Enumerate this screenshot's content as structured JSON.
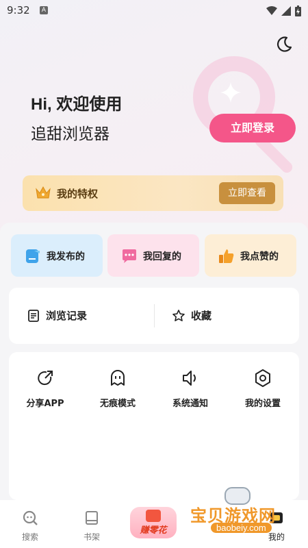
{
  "status": {
    "time": "9:32",
    "badge": "A"
  },
  "header": {
    "greeting": "Hi, 欢迎使用",
    "app_name": "追甜浏览器",
    "login_label": "立即登录"
  },
  "privilege": {
    "label": "我的特权",
    "button": "立即查看"
  },
  "quick_tiles": [
    {
      "label": "我发布的",
      "icon": "post-icon",
      "color": "#3fa3ea"
    },
    {
      "label": "我回复的",
      "icon": "chat-icon",
      "color": "#f06a9f"
    },
    {
      "label": "我点赞的",
      "icon": "thumbs-up-icon",
      "color": "#f5a12b"
    }
  ],
  "records": {
    "history_label": "浏览记录",
    "favorites_label": "收藏"
  },
  "tools": [
    {
      "label": "分享APP",
      "icon": "share-icon"
    },
    {
      "label": "无痕模式",
      "icon": "ghost-icon"
    },
    {
      "label": "系统通知",
      "icon": "speaker-icon"
    },
    {
      "label": "我的设置",
      "icon": "settings-icon"
    }
  ],
  "tabbar": {
    "search": "搜索",
    "bookshelf": "书架",
    "earn": "赚零花",
    "mine": "我的"
  },
  "watermark": {
    "title": "宝贝游戏网",
    "url": "baobeiy.com"
  },
  "colors": {
    "accent": "#f45689",
    "gold": "#c8903e"
  }
}
